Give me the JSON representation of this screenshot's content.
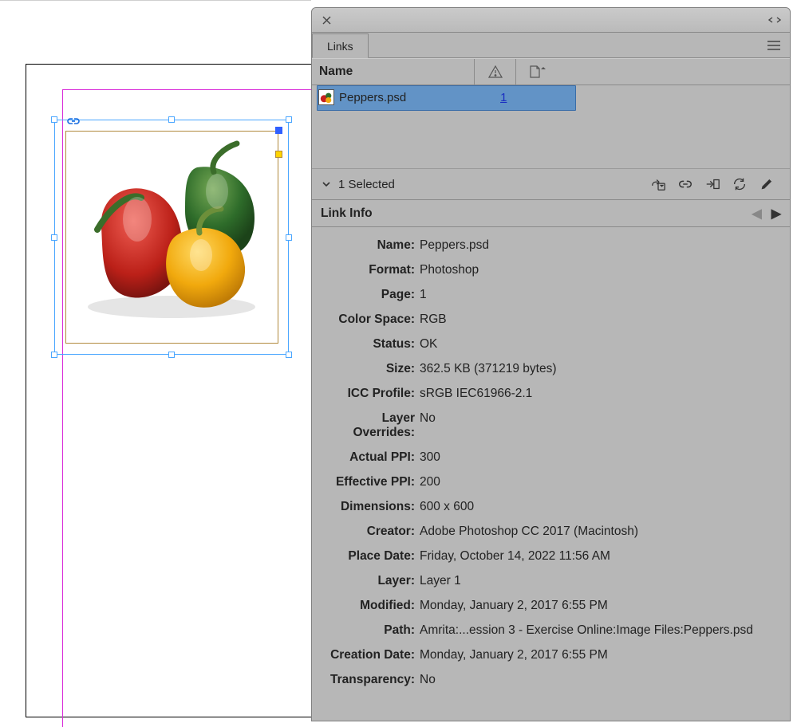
{
  "panel": {
    "tab_label": "Links",
    "header_name": "Name",
    "selected_count": "1 Selected",
    "linkinfo_label": "Link Info"
  },
  "list_item": {
    "filename": "Peppers.psd",
    "instance_count": "1"
  },
  "info": {
    "labels": {
      "name": "Name:",
      "format": "Format:",
      "page": "Page:",
      "color_space": "Color Space:",
      "status": "Status:",
      "size": "Size:",
      "icc": "ICC Profile:",
      "overrides": "Layer Overrides:",
      "actual_ppi": "Actual PPI:",
      "effective_ppi": "Effective PPI:",
      "dimensions": "Dimensions:",
      "creator": "Creator:",
      "place_date": "Place Date:",
      "layer": "Layer:",
      "modified": "Modified:",
      "path": "Path:",
      "creation_date": "Creation Date:",
      "transparency": "Transparency:"
    },
    "values": {
      "name": "Peppers.psd",
      "format": "Photoshop",
      "page": "1",
      "color_space": "RGB",
      "status": "OK",
      "size": "362.5 KB (371219 bytes)",
      "icc": "sRGB IEC61966-2.1",
      "overrides": "No",
      "actual_ppi": "300",
      "effective_ppi": "200",
      "dimensions": "600 x 600",
      "creator": "Adobe Photoshop CC 2017 (Macintosh)",
      "place_date": "Friday, October 14, 2022 11:56 AM",
      "layer": "Layer 1",
      "modified": "Monday, January 2, 2017 6:55 PM",
      "path": "Amrita:...ession 3 - Exercise Online:Image Files:Peppers.psd",
      "creation_date": "Monday, January 2, 2017 6:55 PM",
      "transparency": "No"
    }
  }
}
